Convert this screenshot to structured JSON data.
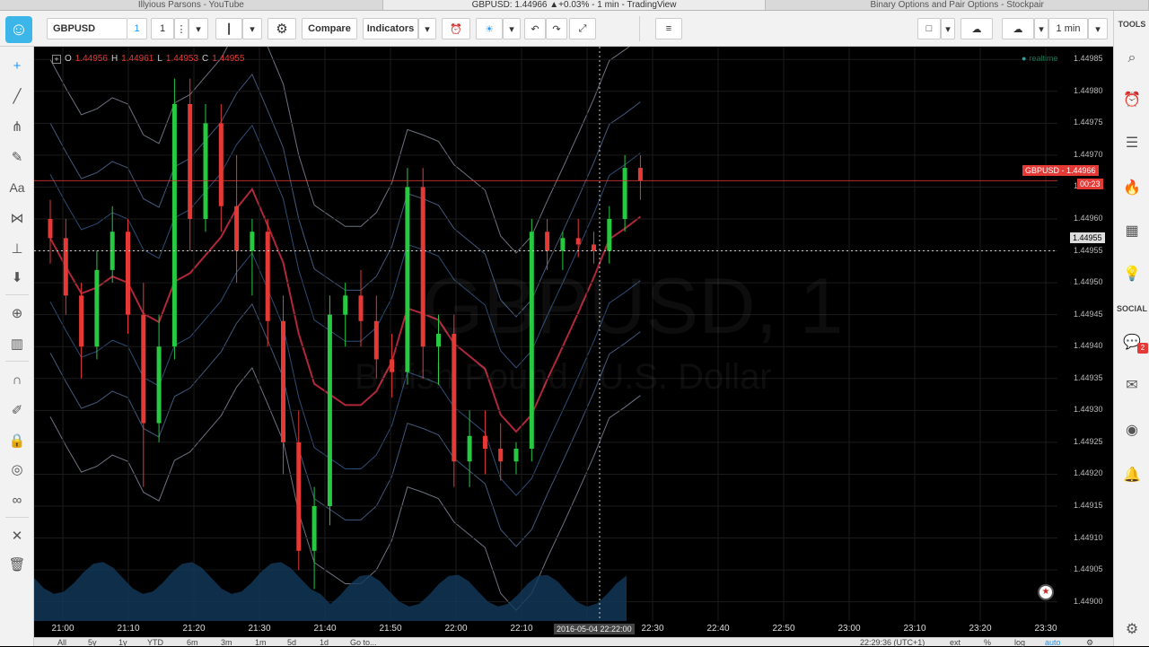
{
  "browser_tabs": [
    {
      "label": "Illyious Parsons - YouTube",
      "active": false
    },
    {
      "label": "GBPUSD: 1.44966 ▲+0.03% - 1 min - TradingView",
      "active": true
    },
    {
      "label": "Binary Options and Pair Options - Stockpair",
      "active": false
    }
  ],
  "toolbar": {
    "symbol": "GBPUSD",
    "interval_badge": "1",
    "interval": "1",
    "compare_label": "Compare",
    "indicators_label": "Indicators",
    "timeframe": "1 min"
  },
  "right_panel": {
    "tools_label": "TOOLS",
    "social_label": "SOCIAL",
    "chat_badge": "2"
  },
  "legend": {
    "o_label": "O",
    "o_value": "1.44956",
    "h_label": "H",
    "h_value": "1.44961",
    "l_label": "L",
    "l_value": "1.44953",
    "c_label": "C",
    "c_value": "1.44955",
    "realtime": "realtime"
  },
  "watermark": {
    "symbol": "GBPUSD, 1",
    "description": "British Pound / U.S. Dollar"
  },
  "price_axis": [
    "1.44985",
    "1.44980",
    "1.44975",
    "1.44970",
    "1.44965",
    "1.44960",
    "1.44955",
    "1.44950",
    "1.44945",
    "1.44940",
    "1.44935",
    "1.44930",
    "1.44925",
    "1.44920",
    "1.44915",
    "1.44910",
    "1.44905",
    "1.44900"
  ],
  "time_axis": [
    "21:00",
    "21:10",
    "21:20",
    "21:30",
    "21:40",
    "21:50",
    "22:00",
    "22:10",
    "22:20",
    "22:30",
    "22:40",
    "22:50",
    "23:00",
    "23:10",
    "23:20",
    "23:30"
  ],
  "price_tag": {
    "label": "GBPUSD - 1.44966",
    "countdown": "00:23",
    "crosshair_price": "1.44955"
  },
  "crosshair_time": "2016-05-04 22:22:00",
  "bottom_bar": {
    "ranges": [
      "All",
      "5y",
      "1y",
      "YTD",
      "6m",
      "3m",
      "1m",
      "5d",
      "1d",
      "Go to..."
    ],
    "clock": "22:29:36 (UTC+1)",
    "ext": "ext",
    "percent": "%",
    "log": "log",
    "auto": "auto"
  },
  "colors": {
    "up": "#26c940",
    "down": "#e53935",
    "background": "#000000",
    "accent": "#2196f3"
  },
  "chart_data": {
    "type": "candlestick",
    "symbol": "GBPUSD",
    "interval": "1 min",
    "ylim": [
      1.44897,
      1.44987
    ],
    "candles": [
      [
        1.4496,
        1.44963,
        1.44953,
        1.44957
      ],
      [
        1.44957,
        1.4496,
        1.44945,
        1.44948
      ],
      [
        1.44948,
        1.4495,
        1.44935,
        1.4494
      ],
      [
        1.4494,
        1.44955,
        1.44938,
        1.44952
      ],
      [
        1.44952,
        1.44962,
        1.4495,
        1.44958
      ],
      [
        1.44958,
        1.4496,
        1.44942,
        1.44945
      ],
      [
        1.44945,
        1.4495,
        1.44918,
        1.44928
      ],
      [
        1.44928,
        1.44945,
        1.44925,
        1.4494
      ],
      [
        1.4494,
        1.44982,
        1.44938,
        1.44978
      ],
      [
        1.44978,
        1.44982,
        1.44955,
        1.4496
      ],
      [
        1.4496,
        1.44978,
        1.44958,
        1.44975
      ],
      [
        1.44975,
        1.44978,
        1.44958,
        1.44962
      ],
      [
        1.44962,
        1.4497,
        1.4495,
        1.44955
      ],
      [
        1.44955,
        1.4496,
        1.44948,
        1.44958
      ],
      [
        1.44958,
        1.4496,
        1.4494,
        1.44944
      ],
      [
        1.44944,
        1.44948,
        1.4492,
        1.44925
      ],
      [
        1.44925,
        1.4493,
        1.44905,
        1.44908
      ],
      [
        1.44908,
        1.44918,
        1.44902,
        1.44915
      ],
      [
        1.44915,
        1.44948,
        1.44912,
        1.44945
      ],
      [
        1.44945,
        1.4495,
        1.4494,
        1.44948
      ],
      [
        1.44948,
        1.44952,
        1.4494,
        1.44944
      ],
      [
        1.44944,
        1.44948,
        1.44935,
        1.44938
      ],
      [
        1.44938,
        1.44942,
        1.44932,
        1.44936
      ],
      [
        1.44936,
        1.44968,
        1.44934,
        1.44965
      ],
      [
        1.44965,
        1.44968,
        1.44935,
        1.4494
      ],
      [
        1.4494,
        1.44945,
        1.44934,
        1.44942
      ],
      [
        1.44942,
        1.44945,
        1.44918,
        1.44922
      ],
      [
        1.44922,
        1.4493,
        1.44918,
        1.44926
      ],
      [
        1.44926,
        1.4493,
        1.4492,
        1.44924
      ],
      [
        1.44924,
        1.44928,
        1.44919,
        1.44922
      ],
      [
        1.44922,
        1.44925,
        1.4492,
        1.44924
      ],
      [
        1.44924,
        1.4496,
        1.44922,
        1.44958
      ],
      [
        1.44958,
        1.4496,
        1.44952,
        1.44955
      ],
      [
        1.44955,
        1.44958,
        1.44952,
        1.44957
      ],
      [
        1.44957,
        1.4496,
        1.44954,
        1.44956
      ],
      [
        1.44956,
        1.44958,
        1.44953,
        1.44955
      ],
      [
        1.44955,
        1.44962,
        1.44953,
        1.4496
      ],
      [
        1.4496,
        1.4497,
        1.44958,
        1.44968
      ],
      [
        1.44968,
        1.4497,
        1.44963,
        1.44966
      ]
    ]
  }
}
